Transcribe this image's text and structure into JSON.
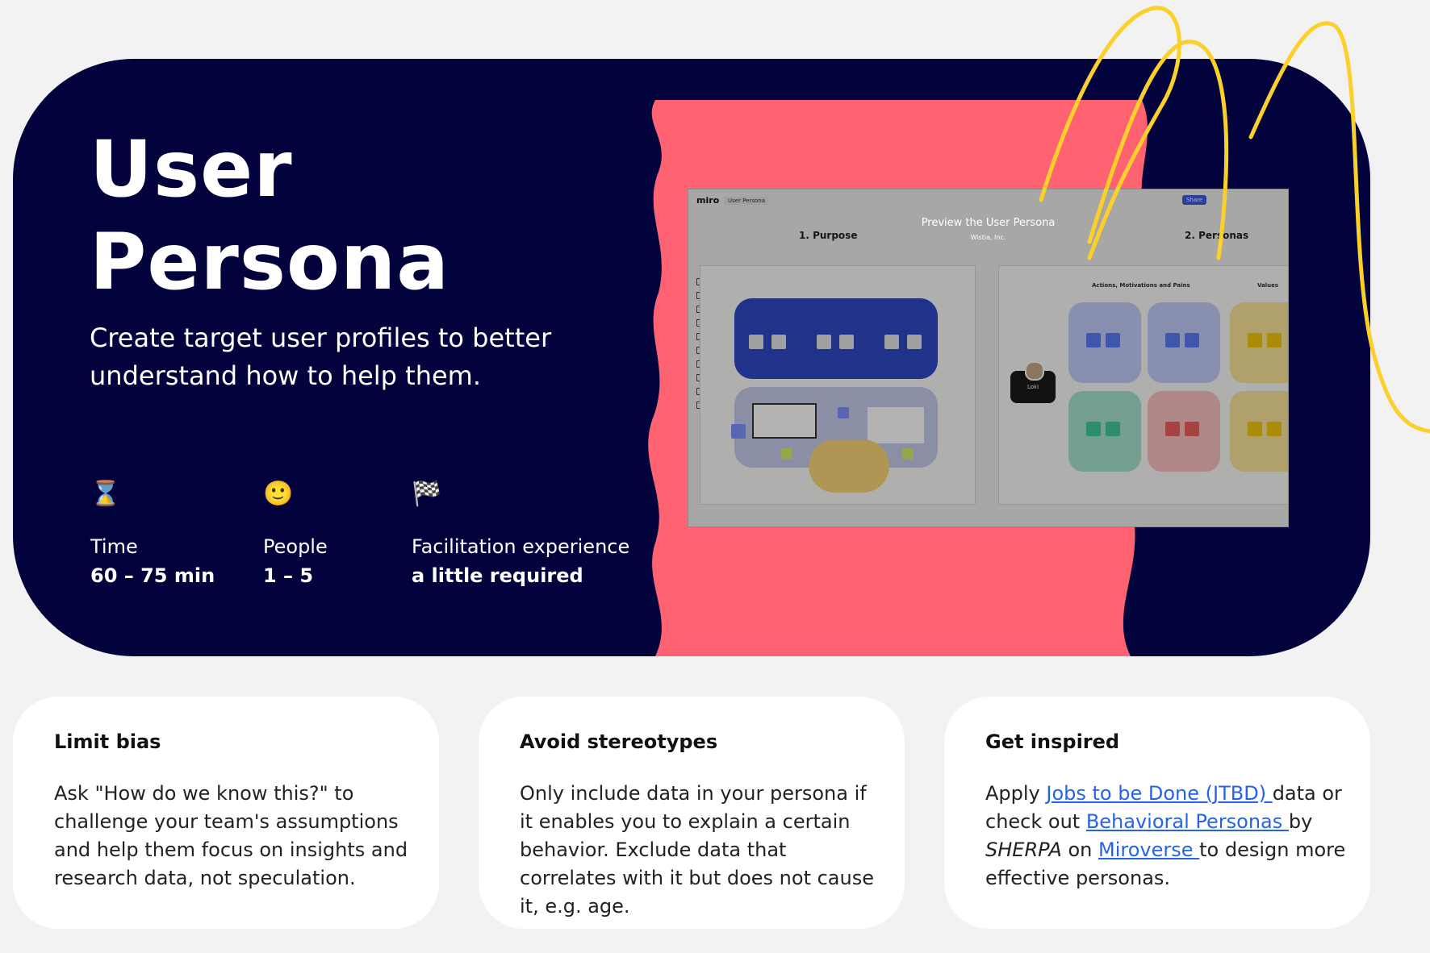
{
  "hero": {
    "title_line1": "User",
    "title_line2": "Persona",
    "subtitle": "Create target user profiles to better understand how to help them.",
    "colors": {
      "background": "#02023c",
      "accent": "#ff6372",
      "squiggle": "#fcd02b"
    },
    "meta": [
      {
        "icon": "hourglass-icon",
        "glyph": "⌛",
        "label": "Time",
        "value": "60 – 75 min"
      },
      {
        "icon": "smiley-icon",
        "glyph": "🙂",
        "label": "People",
        "value": "1 – 5"
      },
      {
        "icon": "checkered-flag-icon",
        "glyph": "🏁",
        "label": "Facilitation experience",
        "value": "a little required"
      }
    ]
  },
  "preview": {
    "app_logo": "miro",
    "board_name": "User Persona",
    "share_label": "Share",
    "heading": "Preview the User Persona",
    "company": "Wistia, Inc.",
    "section_1": "1. Purpose",
    "section_2": "2. Personas",
    "column_header": "Actions, Motivations and Pains",
    "values_label": "Values",
    "persona_name": "Loki"
  },
  "tips": [
    {
      "title": "Limit bias",
      "text": "Ask \"How do we know this?\" to challenge your team's assumptions and help them focus on insights and research data, not speculation."
    },
    {
      "title": "Avoid stereotypes",
      "text": "Only include data in your persona if it enables you to explain a certain behavior. Exclude data that correlates with it but does not cause it, e.g. age."
    },
    {
      "title": "Get inspired",
      "parts": {
        "t1": "Apply ",
        "link1": "Jobs to be Done (JTBD) ",
        "t2": "data or check out ",
        "link2": "Behavioral Personas ",
        "t3": "by ",
        "em": "SHERPA",
        "t4": " on ",
        "link3": "Miroverse ",
        "t5": "to design more effective personas."
      }
    }
  ]
}
